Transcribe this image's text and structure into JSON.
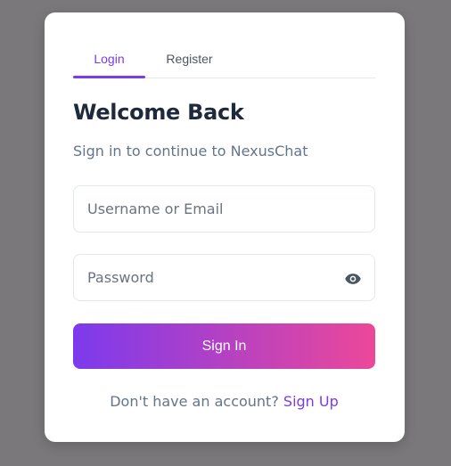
{
  "tabs": {
    "login": "Login",
    "register": "Register",
    "active": "Login"
  },
  "heading": {
    "title": "Welcome Back",
    "subtitle": "Sign in to continue to NexusChat"
  },
  "form": {
    "username": {
      "value": "",
      "placeholder": "Username or Email"
    },
    "password": {
      "value": "",
      "placeholder": "Password"
    },
    "password_toggle_icon": "eye-icon",
    "submit_label": "Sign In"
  },
  "footer": {
    "prompt": "Don't have an account?",
    "link": "Sign Up"
  },
  "colors": {
    "background": "#7a787b",
    "accent": "#7c3aed",
    "gradient_end": "#ec4899",
    "heading": "#1e293b",
    "muted": "#64748b"
  }
}
